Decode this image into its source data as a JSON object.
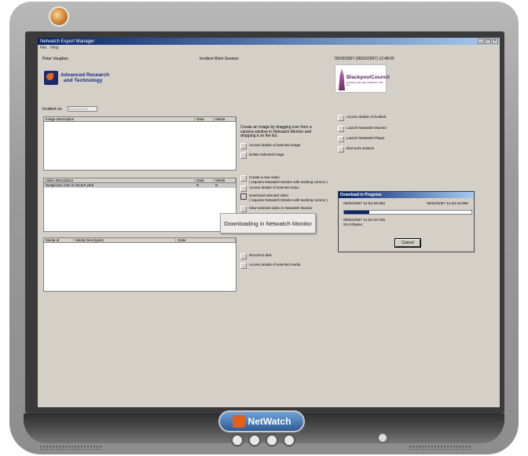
{
  "window": {
    "title": "Netwatch Export Manager",
    "controls": [
      "_",
      "□",
      "×"
    ]
  },
  "menu": [
    "File",
    "Help"
  ],
  "header": {
    "user": "Peter Vaughan",
    "session": "Incident Work Session",
    "datetime": "05/02/2007 (06/01/2007) 12:48:00"
  },
  "art_logo": {
    "line1": "Advanced Research",
    "line2": "and Technology"
  },
  "council_logo": {
    "name": "BlackpoolCouncil",
    "tagline": "BUILDING A BETTER COMMUNITY FOR ALL"
  },
  "incident": {
    "label": "Incident no.",
    "value": "00001050207"
  },
  "image_panel": {
    "headers": [
      "Image Description",
      "Data",
      "Media"
    ],
    "rows": []
  },
  "image_actions": {
    "hint": "Create an image by dragging icon from a camera window in Netwatch Monitor and dropping it on the list.",
    "access": "Access details of selected image",
    "delete": "Delete selected image"
  },
  "video_panel": {
    "headers": [
      "Video Description",
      "Data",
      "Media"
    ],
    "rows": [
      {
        "description": "Suspicious men in secure yard",
        "data": "N",
        "media": "N"
      }
    ]
  },
  "video_actions": {
    "create": "Create a new video",
    "create_note": "( requires Netwatch Monitor with working comms )",
    "access": "Access details of selected video",
    "download": "Download selected video",
    "download_note": "( requires Netwatch Monitor with working comms )",
    "view": "View selected video in Netwatch Monitor"
  },
  "media_panel": {
    "headers": [
      "Media Id",
      "Media Description",
      "State"
    ],
    "rows": []
  },
  "media_actions": {
    "record": "Record to disk",
    "access": "Access details of selected media"
  },
  "incident_actions": {
    "access": "Access details of incident",
    "launch_monitor": "Launch Netwatch Monitor",
    "launch_player": "Launch Netwatch Player",
    "end": "End work session"
  },
  "tooltip": "Downloading in Netwatch Monitor",
  "download_dialog": {
    "title": "Download in Progress",
    "start": "05/02/2007 11:52:26:082",
    "end": "05/02/2007 11:53:44:585",
    "current": "05/02/2007 11:52:43:106",
    "size": "914 Kbytes",
    "progress": 0.2,
    "cancel": "Cancel"
  },
  "monitor": {
    "brand": "NetWatch"
  },
  "colors": {
    "titlebar": "#0a246a",
    "dialog_bg": "#d4d0c8",
    "progress": "#0a246a"
  }
}
